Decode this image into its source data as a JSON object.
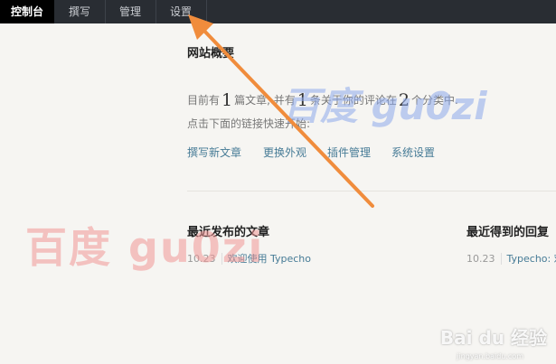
{
  "nav": {
    "items": [
      {
        "label": "控制台",
        "active": true
      },
      {
        "label": "撰写",
        "active": false
      },
      {
        "label": "管理",
        "active": false
      },
      {
        "label": "设置",
        "active": false
      }
    ]
  },
  "overview": {
    "title": "网站概要",
    "stats_prefix": "目前有",
    "posts_count": "1",
    "posts_unit": "篇文章, 并有",
    "comments_count": "1",
    "comments_unit": "条关于你的评论在",
    "categories_count": "2",
    "categories_unit": "个分类中.",
    "hint": "点击下面的链接快速开始:"
  },
  "quick_links": [
    "撰写新文章",
    "更换外观",
    "插件管理",
    "系统设置"
  ],
  "recent_posts": {
    "title": "最近发布的文章",
    "items": [
      {
        "date": "10.23",
        "title": "欢迎使用 Typecho"
      }
    ]
  },
  "recent_replies": {
    "title": "最近得到的回复",
    "items": [
      {
        "date": "10.23",
        "title": "Typecho: 欢"
      }
    ]
  },
  "watermarks": {
    "red": "百度 gu0zi",
    "blue": "百度 gu0zi"
  },
  "baidu": {
    "logo": "Bai du 经验",
    "url": "jingyan.baidu.com"
  },
  "colors": {
    "topbar": "#292d33",
    "accent_link": "#467b96",
    "arrow": "#f08c3c"
  }
}
